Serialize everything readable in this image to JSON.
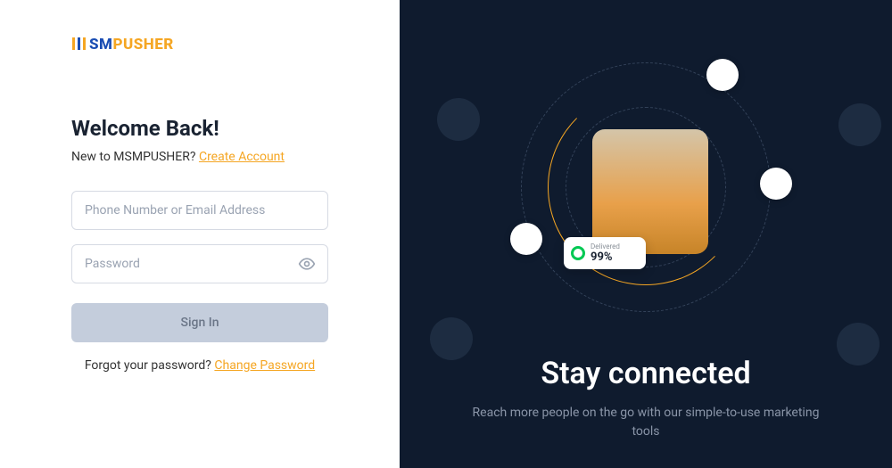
{
  "logo": {
    "sm": "SM",
    "pusher": "PUSHER"
  },
  "heading": "Welcome Back!",
  "subtext": "New to MSMPUSHER? ",
  "create_link": "Create Account",
  "inputs": {
    "identifier_placeholder": "Phone Number or Email Address",
    "password_placeholder": "Password"
  },
  "signin_label": "Sign In",
  "forgot_text": "Forgot your password? ",
  "change_password_link": "Change Password",
  "hero": {
    "title": "Stay connected",
    "subtitle": "Reach more people on the go with our simple-to-use marketing tools",
    "delivered_label": "Delivered",
    "delivered_value": "99%"
  }
}
